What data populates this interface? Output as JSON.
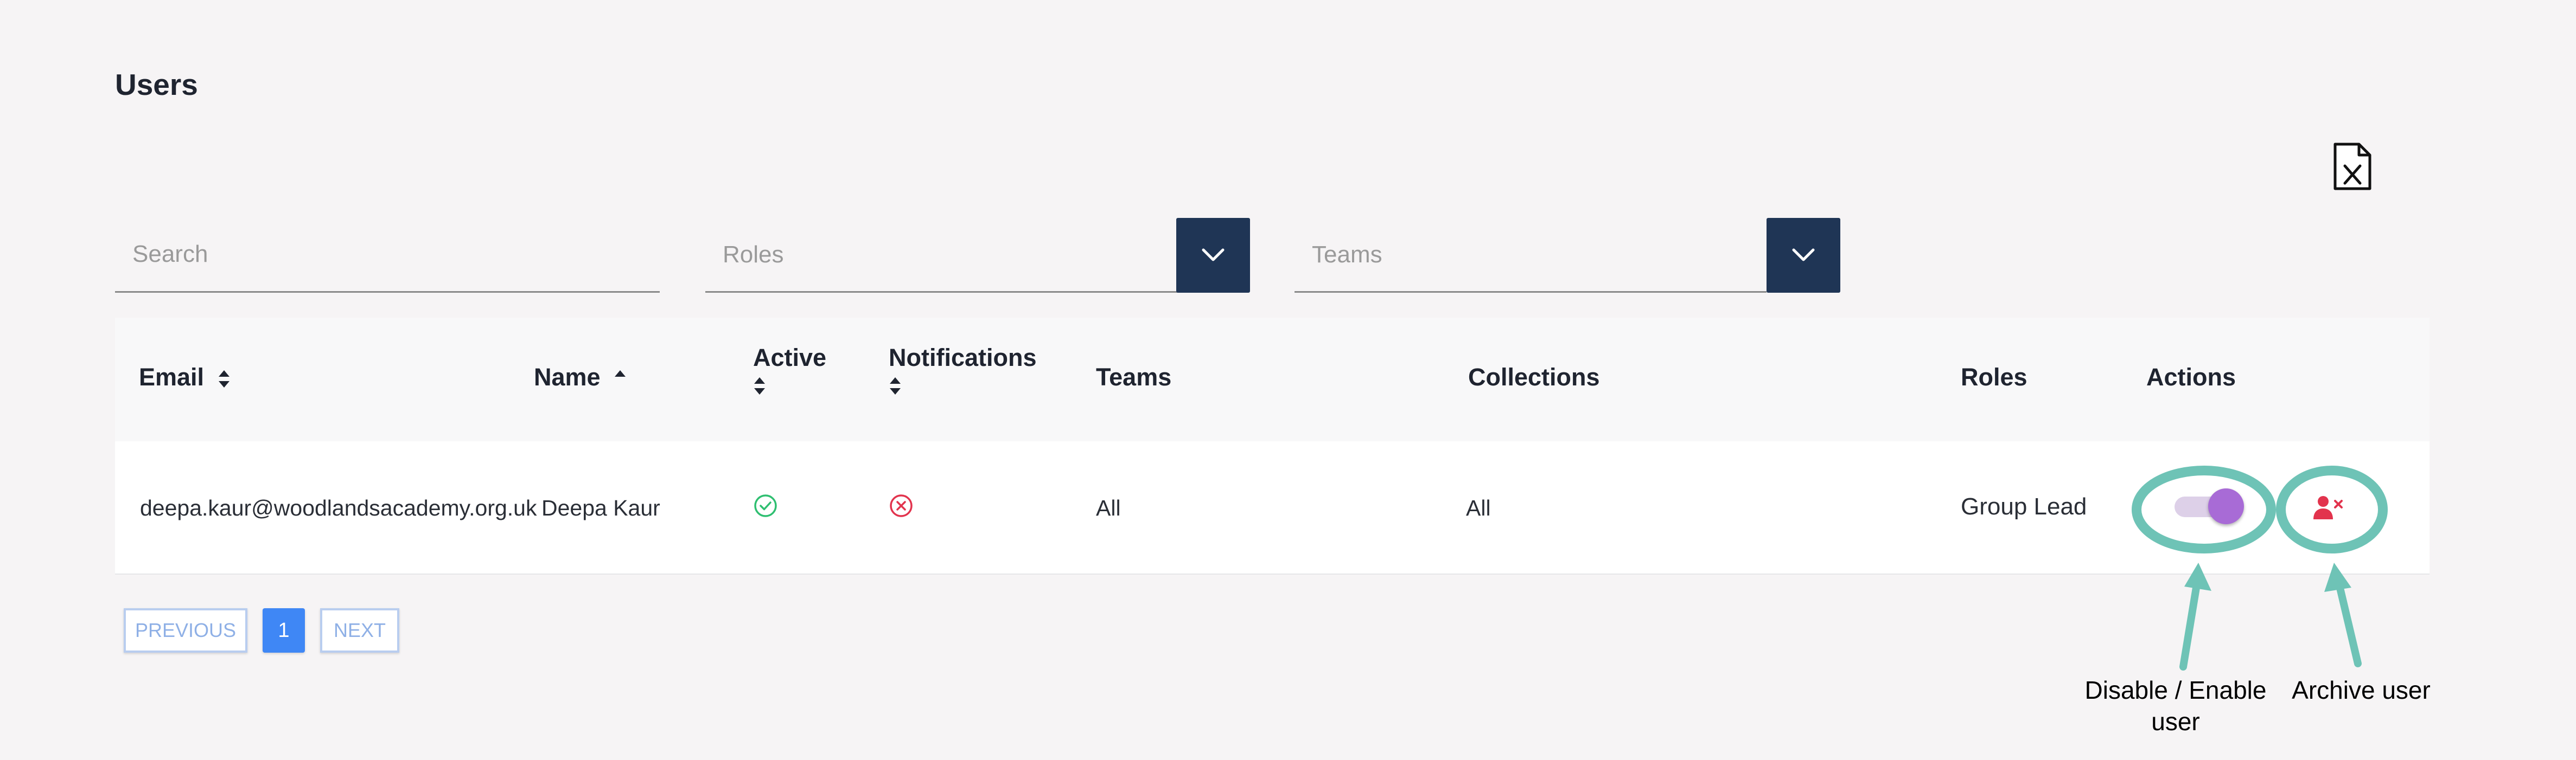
{
  "page": {
    "title": "Users"
  },
  "export": {
    "icon": "excel-export-icon"
  },
  "filters": {
    "search_placeholder": "Search",
    "roles_placeholder": "Roles",
    "teams_placeholder": "Teams"
  },
  "table": {
    "headers": {
      "email": "Email",
      "name": "Name",
      "active": "Active",
      "notifications": "Notifications",
      "teams": "Teams",
      "collections": "Collections",
      "roles": "Roles",
      "actions": "Actions"
    },
    "rows": [
      {
        "email": "deepa.kaur@woodlandsacademy.org.uk",
        "name": "Deepa Kaur",
        "active": true,
        "notifications": false,
        "teams": "All",
        "collections": "All",
        "roles": "Group Lead",
        "enabled": true
      }
    ]
  },
  "pagination": {
    "previous": "PREVIOUS",
    "current": "1",
    "next": "NEXT"
  },
  "annotations": {
    "toggle_label": "Disable / Enable user",
    "archive_label": "Archive user"
  },
  "colors": {
    "accent": "#3f87f5",
    "dropdown": "#1f3555",
    "annotation": "#6ec3b6",
    "toggle": "#a86bd6",
    "active_ok": "#2fbf71",
    "inactive": "#e2334d"
  }
}
